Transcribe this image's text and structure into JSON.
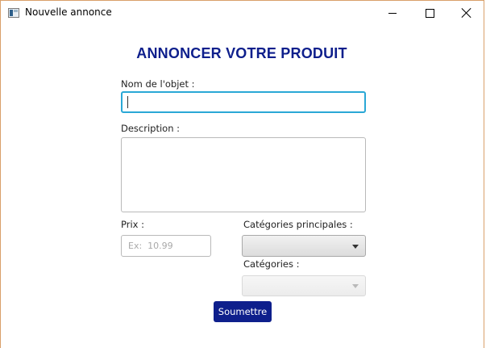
{
  "window": {
    "title": "Nouvelle annonce",
    "app_icon": "window-app-icon",
    "controls": [
      "minimize-icon",
      "maximize-icon",
      "close-icon"
    ]
  },
  "form": {
    "heading": "ANNONCER VOTRE PRODUIT",
    "name_label": "Nom de l'objet :",
    "name_value": "",
    "description_label": "Description :",
    "description_value": "",
    "price_label": "Prix :",
    "price_placeholder": "Ex:  10.99",
    "main_categories_label": "Catégories principales :",
    "main_categories_value": "",
    "categories_label": "Catégories :",
    "categories_value": "",
    "submit_label": "Soumettre"
  },
  "colors": {
    "heading": "#0e1f8c",
    "submit_bg": "#0e1f8c",
    "focus_border": "#2aa8d6",
    "window_border": "#d9a06a"
  }
}
